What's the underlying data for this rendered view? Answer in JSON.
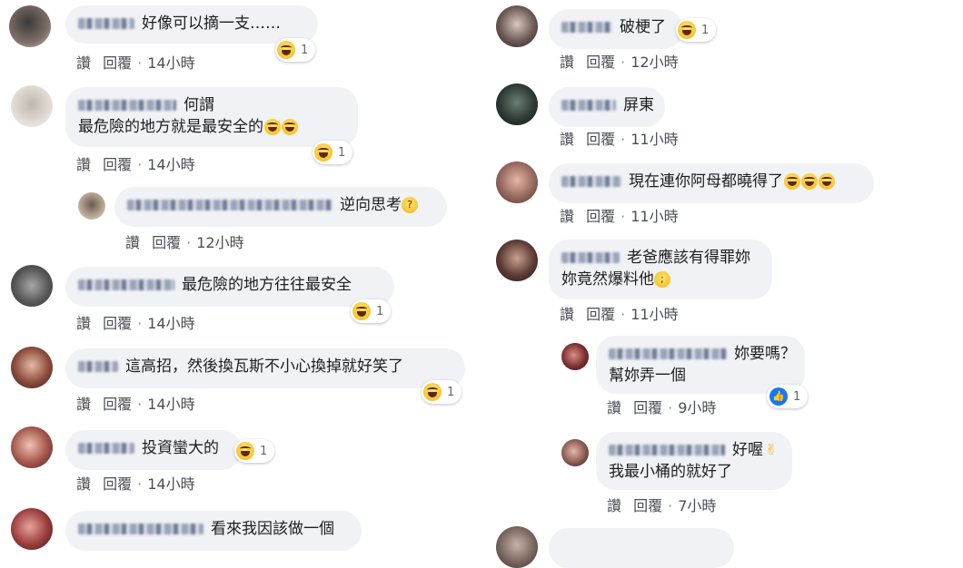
{
  "actions": {
    "like": "讚",
    "reply": "回覆",
    "sep": "·"
  },
  "comments": {
    "c1": {
      "text": "好像可以摘一支……",
      "time": "14小時",
      "reactions": "1"
    },
    "c2": {
      "line1": "何謂",
      "line2": "最危險的地方就是最安全的",
      "time": "14小時",
      "reactions": "1"
    },
    "c2r": {
      "text": "逆向思考",
      "time": "12小時"
    },
    "c3": {
      "text": "最危險的地方往往最安全",
      "time": "14小時",
      "reactions": "1"
    },
    "c4": {
      "text": "這高招，然後換瓦斯不小心換掉就好笑了",
      "time": "14小時",
      "reactions": "1"
    },
    "c5": {
      "text": "投資蠻大的",
      "time": "14小時",
      "reactions": "1"
    },
    "c6": {
      "text": "看來我因該做一個"
    },
    "r1": {
      "text": "破梗了",
      "time": "12小時",
      "reactions": "1"
    },
    "r2": {
      "text": "屏東",
      "time": "11小時"
    },
    "r3": {
      "text": "現在連你阿母都曉得了",
      "time": "11小時"
    },
    "r4": {
      "line1": "老爸應該有得罪妳",
      "line2": "妳竟然爆料他",
      "time": "11小時"
    },
    "r4a": {
      "line1": "妳要嗎？",
      "line2": "幫妳弄一個",
      "time": "9小時",
      "reactions": "1"
    },
    "r4b": {
      "line1": "好喔",
      "line2": "我最小桶的就好了",
      "time": "7小時"
    }
  },
  "colors": {
    "bubble": "#f0f2f5",
    "meta": "#4b4f56",
    "like_blue": "#1877f2"
  },
  "icons": [
    "laugh-emoji",
    "thinking-emoji",
    "crying-emoji",
    "ok-hand-emoji",
    "like-icon"
  ]
}
